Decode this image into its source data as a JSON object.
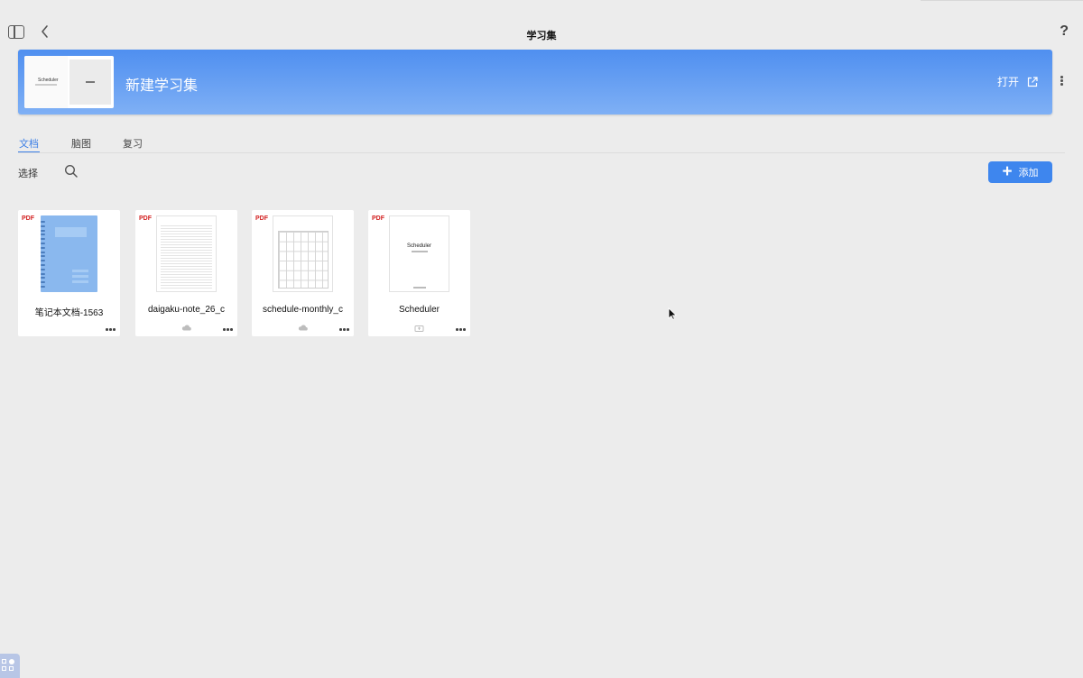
{
  "header": {
    "title": "学习集",
    "help_label": "?"
  },
  "banner": {
    "title": "新建学习集",
    "thumb_title": "Scheduler",
    "open_label": "打开"
  },
  "tabs": [
    {
      "label": "文档",
      "active": true
    },
    {
      "label": "脑图",
      "active": false
    },
    {
      "label": "复习",
      "active": false
    }
  ],
  "toolbar": {
    "select_label": "选择",
    "add_label": "添加"
  },
  "documents": [
    {
      "type_badge": "PDF",
      "name": "笔记本文档-1563",
      "cloud_status": "",
      "thumb_style": "notebook"
    },
    {
      "type_badge": "PDF",
      "name": "daigaku-note_26_c",
      "cloud_status": "cloud-synced",
      "thumb_style": "lined"
    },
    {
      "type_badge": "PDF",
      "name": "schedule-monthly_c",
      "cloud_status": "cloud-synced",
      "thumb_style": "grid"
    },
    {
      "type_badge": "PDF",
      "name": "Scheduler",
      "cloud_status": "cloud-pending",
      "thumb_style": "scheduler"
    }
  ],
  "colors": {
    "accent": "#3e86ee",
    "banner_top": "#4f8ff0",
    "banner_bottom": "#7fb0f5",
    "pdf_badge": "#d21f1f",
    "background": "#ececec"
  }
}
